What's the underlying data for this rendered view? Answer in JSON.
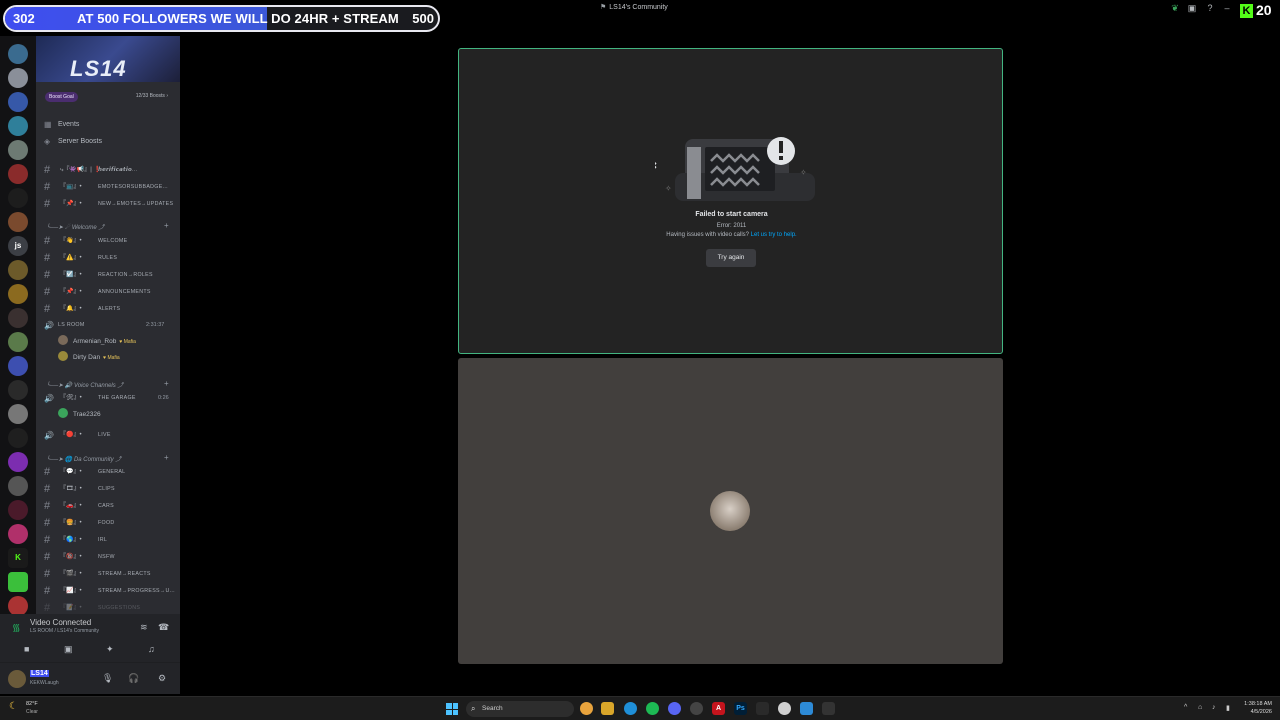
{
  "window": {
    "title": "LS14's Community"
  },
  "overlay": {
    "current": "302",
    "message": "AT 500 FOLLOWERS WE WILL DO 24HR + STREAM",
    "target": "500",
    "progress_fraction": 0.604,
    "kick_count": "20"
  },
  "server_panel": {
    "banner_text": "LS14",
    "boost_goal_label": "Boost Goal",
    "boost_count": "12/33 Boosts",
    "events": "Events",
    "server_boosts": "Server Boosts",
    "channels_top": [
      {
        "emoji": "⤷『👾📢』| ❗",
        "name": "𝙝𝙚𝙧𝙞𝙛𝙞𝙘𝙖𝙩𝙞𝙤..."
      },
      {
        "emoji": "『📺』•",
        "name": "EMOTESORSUBBADGE..."
      },
      {
        "emoji": "『📌』•",
        "name": "NEW→EMOTES→UPDATES"
      }
    ],
    "cat_welcome": "╰──➤ ☄ Welcome ⤴",
    "channels_welcome": [
      {
        "emoji": "『👋』•",
        "name": "WELCOME"
      },
      {
        "emoji": "『⚠️』•",
        "name": "RULES"
      },
      {
        "emoji": "『☑️』•",
        "name": "REACTION→ROLES"
      },
      {
        "emoji": "『📌』•",
        "name": "ANNOUNCEMENTS"
      },
      {
        "emoji": "『🔔』•",
        "name": "ALERTS"
      }
    ],
    "voice_ls_room": {
      "name": "LS ROOM",
      "timer": "2:31:37"
    },
    "members_ls_room": [
      {
        "name": "Armenian_Rob",
        "tag": "♥ Mafia"
      },
      {
        "name": "Dirty Dan",
        "tag": "♥ Mafia"
      }
    ],
    "cat_voice": "╰──➤ 🔊 Voice Channels ⤴",
    "voice_garage": {
      "emoji": "『🛠』•",
      "name": "THE GARAGE",
      "timer": "0:26"
    },
    "members_garage": [
      {
        "name": "Trae2326"
      }
    ],
    "voice_live": {
      "emoji": "『🔴』•",
      "name": "LIVE"
    },
    "cat_community": "╰──➤ 🌐 Da Community ⤴",
    "channels_community": [
      {
        "emoji": "『💬』•",
        "name": "GENERAL"
      },
      {
        "emoji": "『🎞』•",
        "name": "CLIPS"
      },
      {
        "emoji": "『🚗』•",
        "name": "CARS"
      },
      {
        "emoji": "『🍔』•",
        "name": "FOOD"
      },
      {
        "emoji": "『🌎』•",
        "name": "IRL"
      },
      {
        "emoji": "『🔞』•",
        "name": "NSFW"
      },
      {
        "emoji": "『🎬』•",
        "name": "STREAM→REACTS"
      },
      {
        "emoji": "『📈』•",
        "name": "STREAM→PROGRESS→U..."
      },
      {
        "emoji": "『📝』•",
        "name": "SUGGESTIONS"
      }
    ]
  },
  "voice_bar": {
    "status": "Video Connected",
    "location": "LS ROOM / LS14's Community"
  },
  "user": {
    "name": "LS14",
    "status": "KEKWLaugh"
  },
  "camera_error": {
    "title": "Failed to start camera",
    "error": "Error: 2011",
    "help_prefix": "Having issues with video calls?",
    "help_link": "Let us try to help.",
    "button": "Try again"
  },
  "taskbar": {
    "temp": "82°F",
    "condition": "Clear",
    "search_placeholder": "Search",
    "time": "1:38:18 AM",
    "date": "4/5/2026"
  },
  "colors": {
    "accent": "#5865f2",
    "speaking_border": "#43b581",
    "online": "#23a55a",
    "kick": "#53fc18"
  }
}
